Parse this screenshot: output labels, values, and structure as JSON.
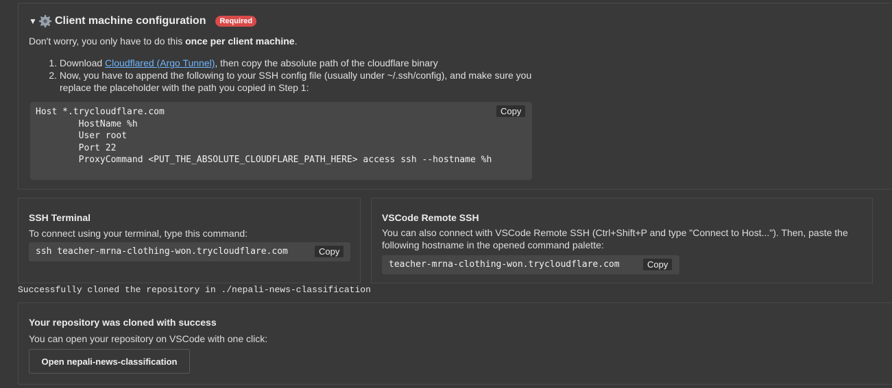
{
  "client_config": {
    "toggle_icon": "triangle-down-icon",
    "gear_icon": "gear-icon",
    "title": "Client machine configuration",
    "required_badge": "Required",
    "intro_prefix": "Don't worry, you only have to do this ",
    "intro_bold": "once per client machine",
    "intro_suffix": ".",
    "step1_num": "1.",
    "step1_prefix": "Download ",
    "step1_link": "Cloudflared (Argo Tunnel)",
    "step1_suffix": ", then copy the absolute path of the cloudflare binary",
    "step2_num": "2.",
    "step2_line1": "Now, you have to append the following to your SSH config file (usually under ~/.ssh/config), and make sure you",
    "step2_line2": "replace the placeholder with the path you copied in Step 1:",
    "code": "Host *.trycloudflare.com\n        HostName %h\n        User root\n        Port 22\n        ProxyCommand <PUT_THE_ABSOLUTE_CLOUDFLARE_PATH_HERE> access ssh --hostname %h",
    "copy_label": "Copy"
  },
  "ssh_terminal": {
    "title": "SSH Terminal",
    "description": "To connect using your terminal, type this command:",
    "command": "ssh teacher-mrna-clothing-won.trycloudflare.com",
    "copy_label": "Copy"
  },
  "vscode_remote": {
    "title": "VSCode Remote SSH",
    "description_line1": "You can also connect with VSCode Remote SSH (Ctrl+Shift+P and type \"Connect to Host...\"). Then, paste the",
    "description_line2": "following hostname in the opened command palette:",
    "hostname": "teacher-mrna-clothing-won.trycloudflare.com",
    "copy_label": "Copy"
  },
  "log": {
    "message": "Successfully cloned the repository in ./nepali-news-classification"
  },
  "repo_card": {
    "title": "Your repository was cloned with success",
    "description": "You can open your repository on VSCode with one click:",
    "open_button": "Open nepali-news-classification"
  },
  "colors": {
    "background": "#383838",
    "code_bg": "#474747",
    "badge": "#d94a4a",
    "link": "#6fb6ff"
  }
}
